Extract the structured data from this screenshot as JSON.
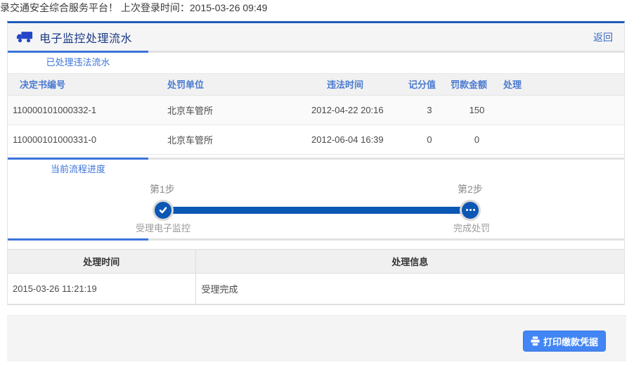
{
  "page": {
    "welcome_text": "录交通安全综合服务平台！ 上次登录时间：2015-03-26 09:49"
  },
  "panel": {
    "title": "电子监控处理流水",
    "back_label": "返回",
    "tab_processed": "已处理违法流水",
    "tab_progress": "当前流程进度"
  },
  "violations_table": {
    "headers": [
      "决定书编号",
      "处罚单位",
      "违法时间",
      "记分值",
      "罚款金额",
      "处理"
    ],
    "rows": [
      {
        "decision_no": "110000101000332-1",
        "unit": "北京车管所",
        "time": "2012-04-22 20:16",
        "points": "3",
        "fine": "150",
        "action": ""
      },
      {
        "decision_no": "110000101000331-0",
        "unit": "北京车管所",
        "time": "2012-06-04 16:39",
        "points": "0",
        "fine": "0",
        "action": ""
      }
    ]
  },
  "progress": {
    "steps": [
      {
        "step_label": "第1步",
        "name": "受理电子监控",
        "status": "completed"
      },
      {
        "step_label": "第2步",
        "name": "完成处罚",
        "status": "pending"
      }
    ]
  },
  "process_table": {
    "headers": [
      "处理时间",
      "处理信息"
    ],
    "rows": [
      {
        "time": "2015-03-26 11:21:19",
        "info": "受理完成"
      }
    ]
  },
  "footer": {
    "print_button_label": "打印缴款凭据"
  },
  "colors": {
    "panel_top_border": "#1e5bb8",
    "title_text": "#1c3a85",
    "accent_blue": "#3d74d8",
    "table_header_blue": "#4a7ad0",
    "progress_blue": "#0b57b4",
    "button_blue": "#4285f4"
  }
}
